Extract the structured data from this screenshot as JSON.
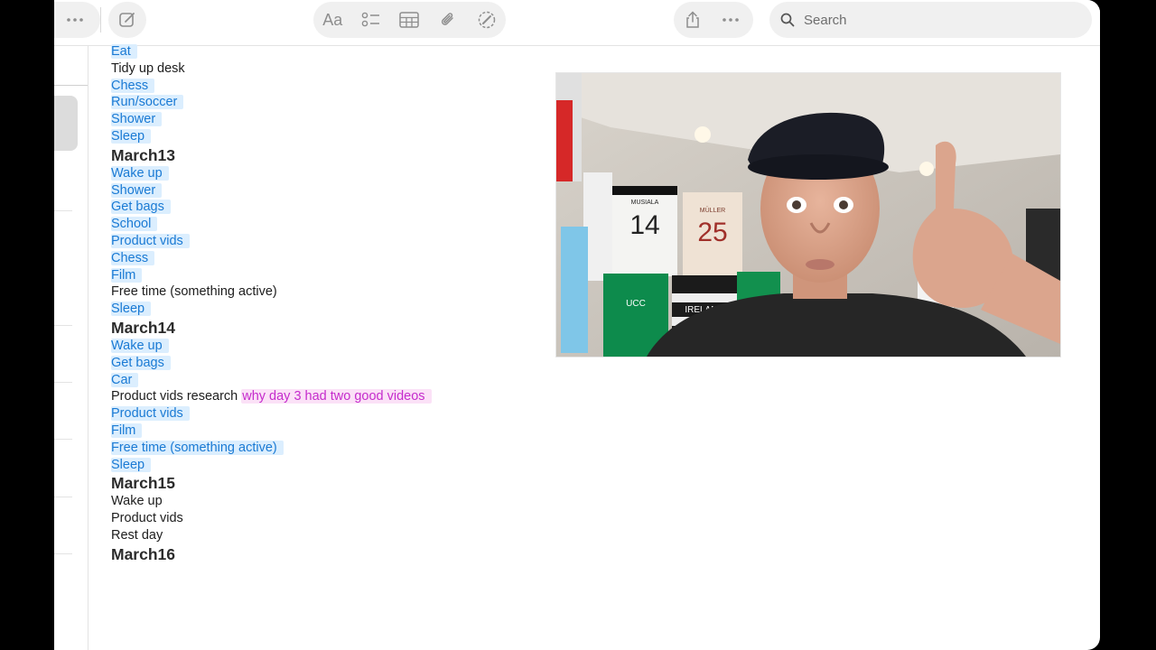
{
  "search": {
    "placeholder": "Search"
  },
  "toolbar": {
    "format_label": "Aa"
  },
  "note": {
    "lines": [
      {
        "text": "Eat",
        "style": "hl"
      },
      {
        "text": "Tidy up desk",
        "style": "plain"
      },
      {
        "text": "Chess",
        "style": "hl"
      },
      {
        "text": "Run/soccer",
        "style": "hl"
      },
      {
        "text": "Shower",
        "style": "hl"
      },
      {
        "text": "Sleep",
        "style": "hl"
      },
      {
        "text": "March13",
        "style": "heading"
      },
      {
        "text": "Wake up",
        "style": "hl"
      },
      {
        "text": "Shower",
        "style": "hl"
      },
      {
        "text": "Get bags",
        "style": "hl"
      },
      {
        "text": "School",
        "style": "hl"
      },
      {
        "text": "Product vids",
        "style": "hl"
      },
      {
        "text": "Chess",
        "style": "hl"
      },
      {
        "text": "Film",
        "style": "hl"
      },
      {
        "text": "Free time (something active)",
        "style": "plain"
      },
      {
        "text": "Sleep",
        "style": "hl"
      },
      {
        "text": "March14",
        "style": "heading"
      },
      {
        "text": "Wake up",
        "style": "hl"
      },
      {
        "text": "Get bags",
        "style": "hl"
      },
      {
        "text": "Car",
        "style": "hl"
      },
      {
        "text": "Product vids research",
        "style": "plain",
        "extra": "why day 3 had two good videos"
      },
      {
        "text": "Product vids",
        "style": "hl"
      },
      {
        "text": "Film",
        "style": "hl"
      },
      {
        "text": "Free time (something active)",
        "style": "hl"
      },
      {
        "text": "Sleep",
        "style": "hl"
      },
      {
        "text": "March15",
        "style": "heading"
      },
      {
        "text": "Wake up",
        "style": "plain"
      },
      {
        "text": "Product vids",
        "style": "plain"
      },
      {
        "text": "Rest day",
        "style": "plain"
      },
      {
        "text": "March16",
        "style": "heading"
      }
    ]
  },
  "photo": {
    "jersey_1_name": "MUSIALA",
    "jersey_1_number": "14",
    "jersey_2_name": "MÜLLER",
    "jersey_2_number": "25",
    "jersey_3_text": "IRELAND",
    "jersey_4_text": "UCC"
  },
  "colors": {
    "highlight_blue": "#1a7ad4",
    "highlight_pink": "#c52ccc"
  }
}
